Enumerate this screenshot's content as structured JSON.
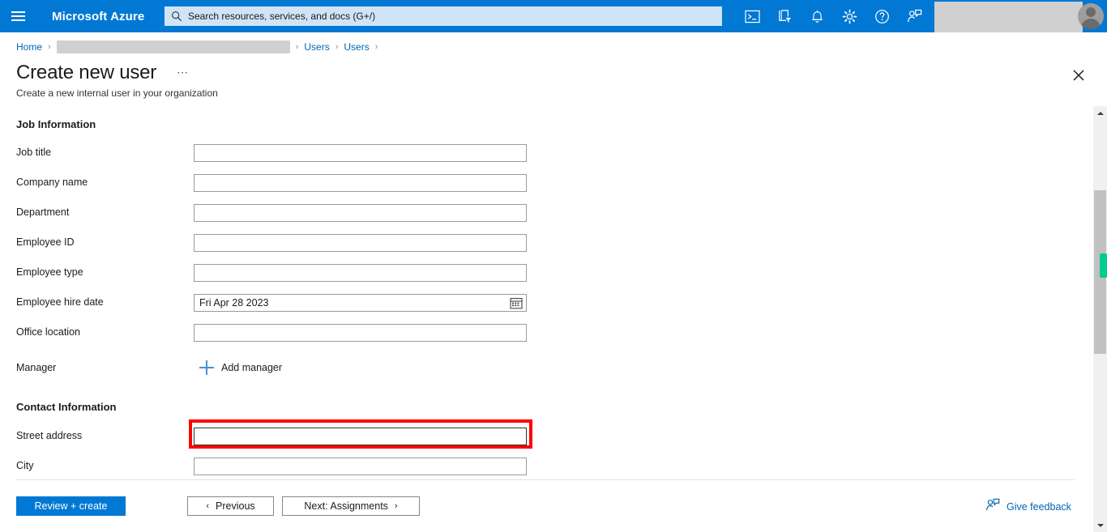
{
  "topnav": {
    "menu_icon": "hamburger-icon",
    "brand": "Microsoft Azure",
    "search": {
      "icon": "search-icon",
      "placeholder": "Search resources, services, and docs (G+/)",
      "value": ""
    },
    "icons": [
      {
        "name": "cloud-shell-icon",
        "title": "Cloud Shell"
      },
      {
        "name": "directories-subscriptions-icon",
        "title": "Directories + subscriptions"
      },
      {
        "name": "notifications-bell-icon",
        "title": "Notifications"
      },
      {
        "name": "settings-gear-icon",
        "title": "Settings"
      },
      {
        "name": "help-question-icon",
        "title": "Help"
      },
      {
        "name": "feedback-person-icon",
        "title": "Feedback"
      }
    ],
    "account_redacted": true,
    "avatar": "user-avatar"
  },
  "breadcrumb": {
    "items": [
      {
        "label": "Home",
        "type": "link"
      },
      {
        "label": "",
        "type": "redacted"
      },
      {
        "label": "Users",
        "type": "link"
      },
      {
        "label": "Users",
        "type": "link"
      }
    ],
    "separator": "›"
  },
  "blade": {
    "title": "Create new user",
    "more_menu": "⋯",
    "subtitle": "Create a new internal user in your organization",
    "close_icon": "close-icon"
  },
  "form": {
    "sections": [
      {
        "heading": "Job Information",
        "fields": [
          {
            "label": "Job title",
            "type": "text",
            "value": "",
            "placeholder": ""
          },
          {
            "label": "Company name",
            "type": "text",
            "value": "",
            "placeholder": ""
          },
          {
            "label": "Department",
            "type": "text",
            "value": "",
            "placeholder": ""
          },
          {
            "label": "Employee ID",
            "type": "text",
            "value": "",
            "placeholder": ""
          },
          {
            "label": "Employee type",
            "type": "text",
            "value": "",
            "placeholder": ""
          },
          {
            "label": "Employee hire date",
            "type": "date",
            "value": "Fri Apr 28 2023",
            "placeholder": "",
            "icon": "calendar-icon"
          },
          {
            "label": "Office location",
            "type": "text",
            "value": "",
            "placeholder": ""
          },
          {
            "label": "Manager",
            "type": "action",
            "action_label": "Add manager",
            "action_icon": "plus-icon"
          }
        ]
      },
      {
        "heading": "Contact Information",
        "fields": [
          {
            "label": "Street address",
            "type": "text",
            "value": "",
            "placeholder": "",
            "highlighted": true,
            "focused": true
          },
          {
            "label": "City",
            "type": "text",
            "value": "",
            "placeholder": ""
          }
        ]
      }
    ]
  },
  "footer": {
    "review_create": "Review + create",
    "previous": "Previous",
    "previous_chevron": "‹",
    "next": "Next: Assignments",
    "next_chevron": "›",
    "give_feedback": "Give feedback",
    "feedback_icon": "feedback-person-icon"
  },
  "scrollbar": {
    "up_arrow": "scroll-up-arrow",
    "down_arrow": "scroll-down-arrow",
    "thumb": "scroll-thumb",
    "marker": "find-match-marker"
  },
  "colors": {
    "azure_blue": "#0078d4",
    "link_blue": "#0065b3",
    "highlight_red": "#ff0000",
    "marker_green": "#00cc92",
    "redact_grey": "#d0d0d0"
  }
}
